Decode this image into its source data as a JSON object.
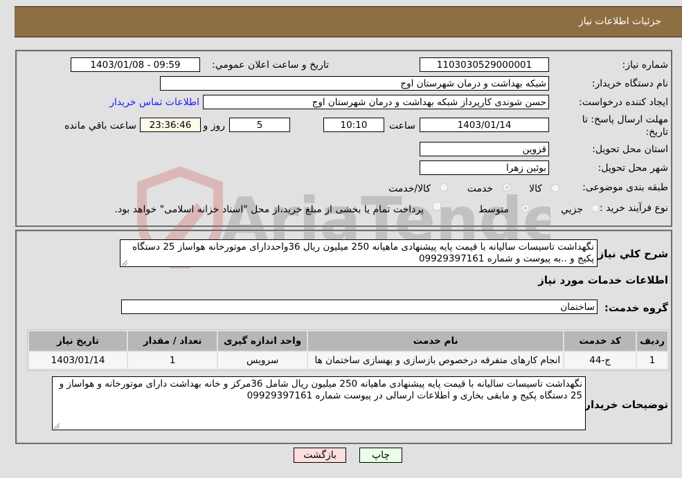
{
  "header": {
    "title": "جزئیات اطلاعات نیاز"
  },
  "form": {
    "need_number": {
      "label": "شماره نیاز:",
      "value": "1103030529000001"
    },
    "announce_datetime": {
      "label": "تاریخ و ساعت اعلان عمومي:",
      "value": "1403/01/08 - 09:59"
    },
    "buyer_org": {
      "label": "نام دستگاه خریدار:",
      "value": "شبکه بهداشت و درمان شهرستان اوج"
    },
    "requester": {
      "label": "ایجاد کننده درخواست:",
      "value": "حسن شوندی کارپرداز شبکه بهداشت و درمان شهرستان اوج"
    },
    "contact_link": "اطلاعات تماس خریدار",
    "deadline": {
      "label_line1": "مهلت ارسال پاسخ: تا",
      "label_line2": "تاریخ:",
      "date": "1403/01/14",
      "time_label": "ساعت",
      "time": "10:10",
      "days": "5",
      "days_label": "روز و",
      "remaining": "23:36:46",
      "remaining_label": "ساعت باقي مانده"
    },
    "province": {
      "label": "استان محل تحویل:",
      "value": "قزوین"
    },
    "city": {
      "label": "شهر محل تحویل:",
      "value": "بوئین زهرا"
    },
    "category": {
      "label": "طبقه بندی موضوعی:",
      "options": [
        "کالا",
        "خدمت",
        "کالا/خدمت"
      ],
      "selected": "خدمت"
    },
    "purchase_type": {
      "label": "نوع فرآیند خرید :",
      "options": [
        "جزيي",
        "متوسط"
      ],
      "selected": "متوسط",
      "treasury_note": "پرداخت تمام یا بخشی از مبلغ خرید،از محل \"اسناد خزانه اسلامی\" خواهد بود."
    }
  },
  "details": {
    "description_label": "شرح کلي نیاز:",
    "description": "نگهداشت تاسیسات سالیانه با قیمت پایه پیشنهادی ماهیانه 250 میلیون ریال  36واحددارای موتورخانه  هواساز 25 دستگاه پکیج و ..به پیوست و شماره 09929397161",
    "services_heading": "اطلاعات خدمات مورد نیاز",
    "service_group_label": "گروه خدمت:",
    "service_group": "ساختمان",
    "table": {
      "headers": [
        "ردیف",
        "کد خدمت",
        "نام خدمت",
        "واحد اندازه گیری",
        "تعداد / مقدار",
        "تاریخ نیاز"
      ],
      "rows": [
        [
          "1",
          "ج-44",
          "انجام کارهای متفرقه درخصوص بازسازی و بهسازی ساختمان ها",
          "سرویس",
          "1",
          "1403/01/14"
        ]
      ]
    },
    "buyer_notes_label": "توضیحات خریدار:",
    "buyer_notes": "نگهداشت تاسیسات سالیانه با قیمت پایه پیشنهادی ماهیانه 250 میلیون ریال شامل 36مرکز و خانه بهداشت دارای موتورخانه و هواساز و 25 دستگاه پکیج و مابقی بخاری و اطلاعات ارسالی در پیوست شماره 09929397161"
  },
  "buttons": {
    "print": "چاپ",
    "back": "بازگشت"
  },
  "watermark": {
    "text": "AriaTender.neT"
  }
}
